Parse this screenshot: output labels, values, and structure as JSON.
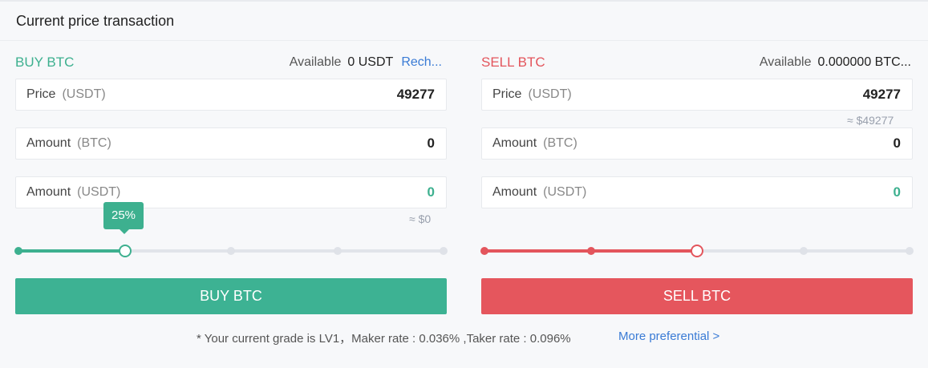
{
  "header": {
    "title": "Current price transaction"
  },
  "buy": {
    "title": "BUY BTC",
    "available_label": "Available",
    "available_value": "0 USDT",
    "recharge_label": "Rech...",
    "price_label": "Price",
    "price_unit": "(USDT)",
    "price_value": "49277",
    "amount_label": "Amount",
    "amount_unit": "(BTC)",
    "amount_value": "0",
    "total_label": "Amount",
    "total_unit": "(USDT)",
    "total_value": "0",
    "total_approx": "≈ $0",
    "slider_tooltip": "25%",
    "slider_percent": 25,
    "button_label": "BUY BTC"
  },
  "sell": {
    "title": "SELL BTC",
    "available_label": "Available",
    "available_value": "0.000000 BTC...",
    "price_label": "Price",
    "price_unit": "(USDT)",
    "price_value": "49277",
    "price_approx": "≈ $49277",
    "amount_label": "Amount",
    "amount_unit": "(BTC)",
    "amount_value": "0",
    "total_label": "Amount",
    "total_unit": "(USDT)",
    "total_value": "0",
    "slider_percent": 50,
    "button_label": "SELL BTC"
  },
  "footer": {
    "note": "* Your current grade is LV1，Maker rate : 0.036% ,Taker rate : 0.096%",
    "more_link": "More preferential >"
  },
  "colors": {
    "buy": "#3db08f",
    "sell": "#e3555c",
    "link": "#3a7bd5"
  }
}
